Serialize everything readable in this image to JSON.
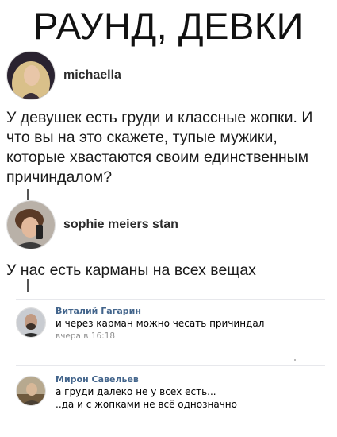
{
  "meme": {
    "title": "РАУНД, ДЕВКИ"
  },
  "post1": {
    "username": "michaella",
    "text": "У девушек есть груди и классные жопки. И что вы на это скажете, тупые мужики, которые хвастаются своим единственным причиндалом?"
  },
  "post2": {
    "username": "sophie meiers stan",
    "text": "У нас есть карманы на всех вещах"
  },
  "comments": [
    {
      "author": "Виталий Гагарин",
      "text": "и через карман можно чесать причиндал",
      "time": "вчера в 16:18"
    },
    {
      "author": "Мирон Савельев",
      "text": "а груди далеко не у всех есть...\n..да и с жопками не всё однозначно"
    }
  ]
}
